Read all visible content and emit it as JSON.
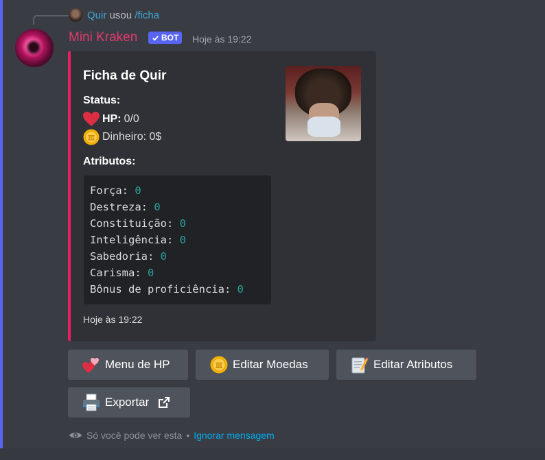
{
  "reply": {
    "username": "Quir",
    "verb": "usou",
    "command": "/ficha"
  },
  "message": {
    "author": "Mini Kraken",
    "bot_tag": "BOT",
    "timestamp": "Hoje às 19:22",
    "author_color": "#e23a6d"
  },
  "embed": {
    "accent_color": "#e91e63",
    "title": "Ficha de Quir",
    "status": {
      "heading": "Status:",
      "hp_label": "HP:",
      "hp_value": "0/0",
      "money_text": "Dinheiro: 0$"
    },
    "attributes": {
      "heading": "Atributos:",
      "rows": [
        {
          "name": "Força: ",
          "value": "0"
        },
        {
          "name": "Destreza: ",
          "value": "0"
        },
        {
          "name": "Constituição: ",
          "value": "0"
        },
        {
          "name": "Inteligência: ",
          "value": "0"
        },
        {
          "name": "Sabedoria: ",
          "value": "0"
        },
        {
          "name": "Carisma: ",
          "value": "0"
        },
        {
          "name": "Bônus de proficiência: ",
          "value": "0"
        }
      ]
    },
    "footer": "Hoje às 19:22"
  },
  "buttons": {
    "hp_menu": {
      "label": "Menu de HP",
      "icon": "two-hearts-icon"
    },
    "edit_coins": {
      "label": "Editar Moedas",
      "icon": "coin-icon"
    },
    "edit_attributes": {
      "label": "Editar Atributos",
      "icon": "memo-icon"
    },
    "export": {
      "label": "Exportar",
      "icon": "printer-icon"
    }
  },
  "ephemeral_note": {
    "text": "Só você pode ver esta",
    "separator": "•",
    "dismiss_link": "Ignorar mensagem"
  }
}
